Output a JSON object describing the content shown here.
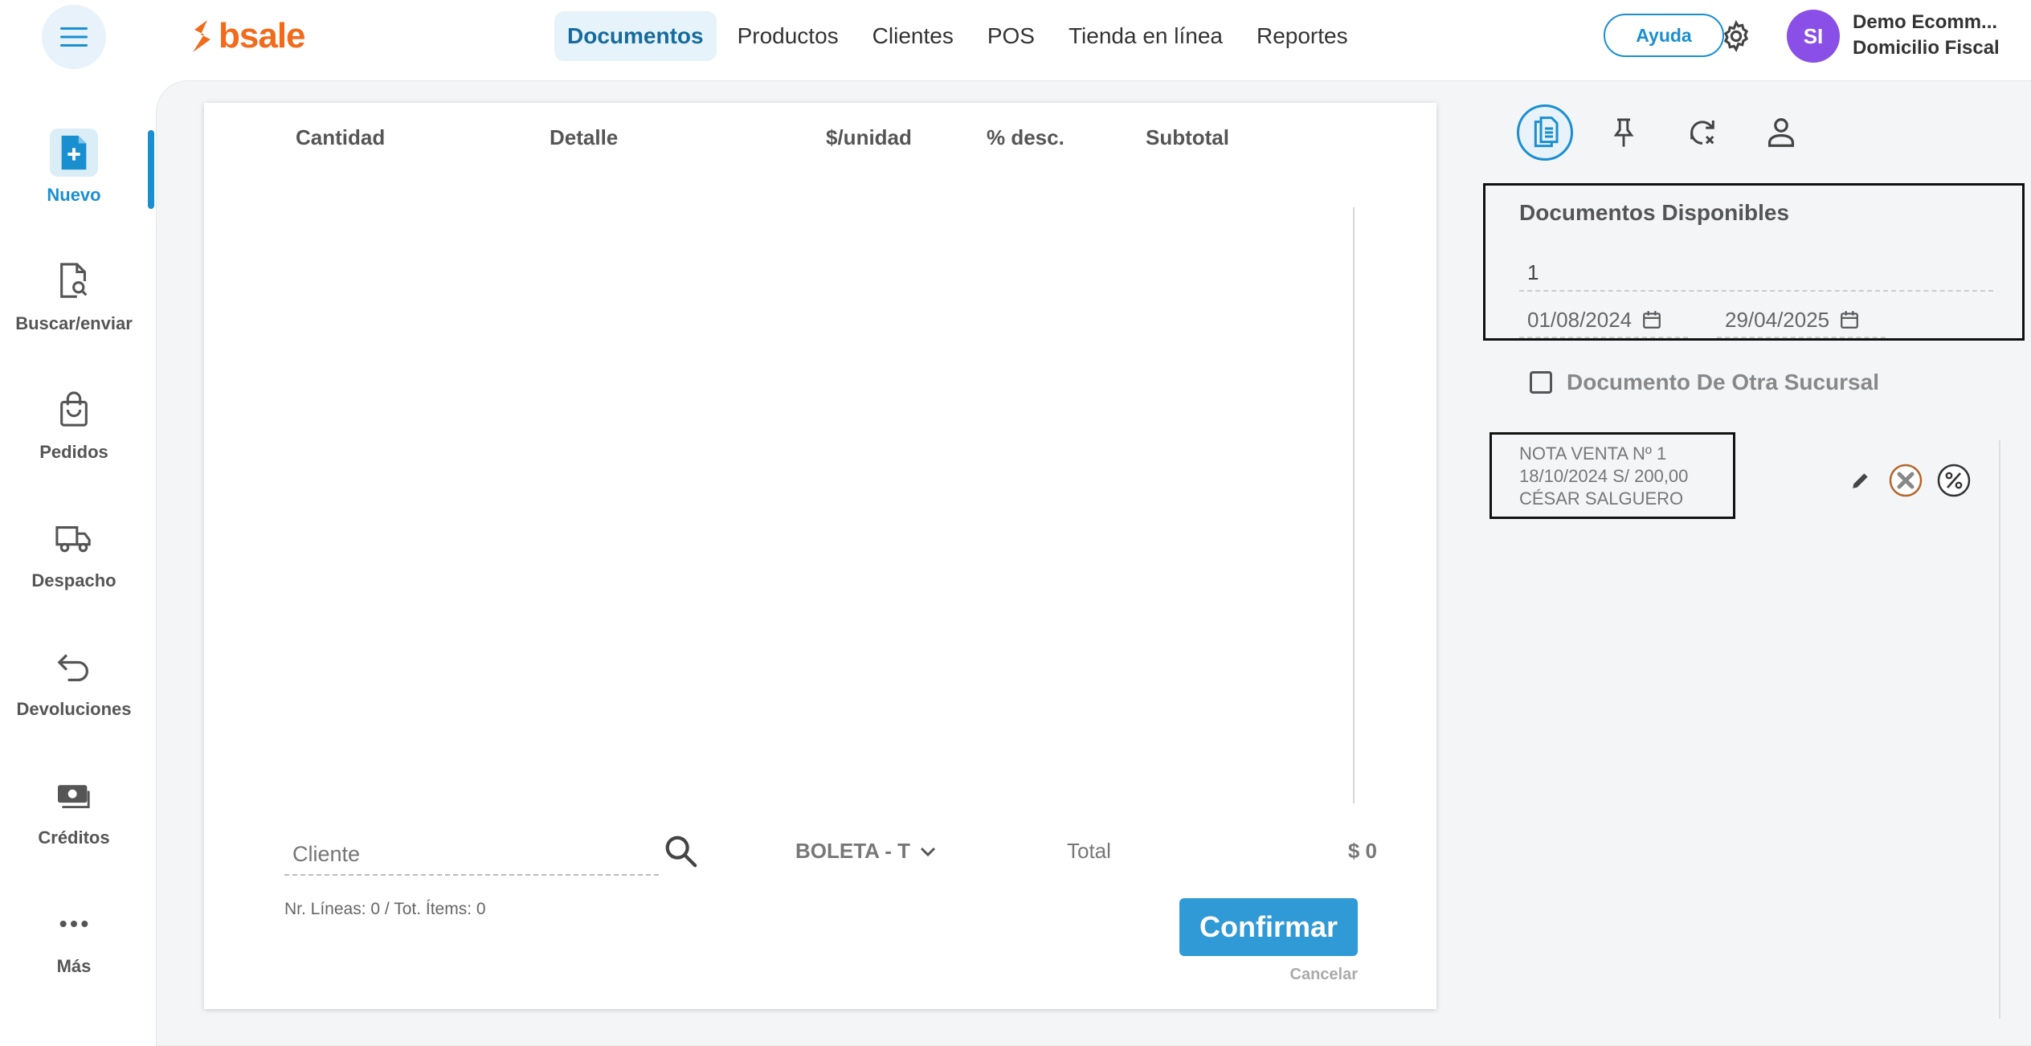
{
  "brand": {
    "logo_text": "bsale",
    "logo_color": "#f26a1b"
  },
  "topnav": {
    "items": [
      {
        "label": "Documentos",
        "active": true
      },
      {
        "label": "Productos"
      },
      {
        "label": "Clientes"
      },
      {
        "label": "POS"
      },
      {
        "label": "Tienda en línea"
      },
      {
        "label": "Reportes"
      }
    ],
    "help_label": "Ayuda",
    "avatar_initials": "SI",
    "account_name": "Demo Ecomm...",
    "account_subtitle": "Domicilio Fiscal"
  },
  "sidebar": {
    "items": [
      {
        "label": "Nuevo",
        "icon": "new-document-icon",
        "active": true
      },
      {
        "label": "Buscar/enviar",
        "icon": "search-document-icon"
      },
      {
        "label": "Pedidos",
        "icon": "shopping-bag-icon"
      },
      {
        "label": "Despacho",
        "icon": "truck-icon"
      },
      {
        "label": "Devoluciones",
        "icon": "return-arrow-icon"
      },
      {
        "label": "Créditos",
        "icon": "cash-icon"
      },
      {
        "label": "Más",
        "icon": "more-dots-icon"
      }
    ]
  },
  "document": {
    "columns": [
      "Cantidad",
      "Detalle",
      "$/unidad",
      "% desc.",
      "Subtotal"
    ],
    "client_placeholder": "Cliente",
    "doc_type": "BOLETA - T",
    "total_label": "Total",
    "total_value": "$ 0",
    "lines_info": "Nr. Líneas: 0 / Tot. Ítems: 0",
    "confirm_label": "Confirmar",
    "cancel_label": "Cancelar"
  },
  "right_panel": {
    "tools": [
      "document-list-icon",
      "pin-icon",
      "sync-cancel-icon",
      "user-icon"
    ],
    "available_title": "Documentos Disponibles",
    "search_value": "1",
    "date_from": "01/08/2024",
    "date_to": "29/04/2025",
    "other_branch_label": "Documento De Otra Sucursal",
    "other_branch_checked": false,
    "doc_card": {
      "line1": "NOTA VENTA Nº 1",
      "line2": "18/10/2024 S/ 200,00",
      "line3": "CÉSAR SALGUERO"
    }
  },
  "colors": {
    "accent": "#1a8fd0",
    "confirm": "#2f9ad6",
    "avatar": "#8a4fe6"
  }
}
